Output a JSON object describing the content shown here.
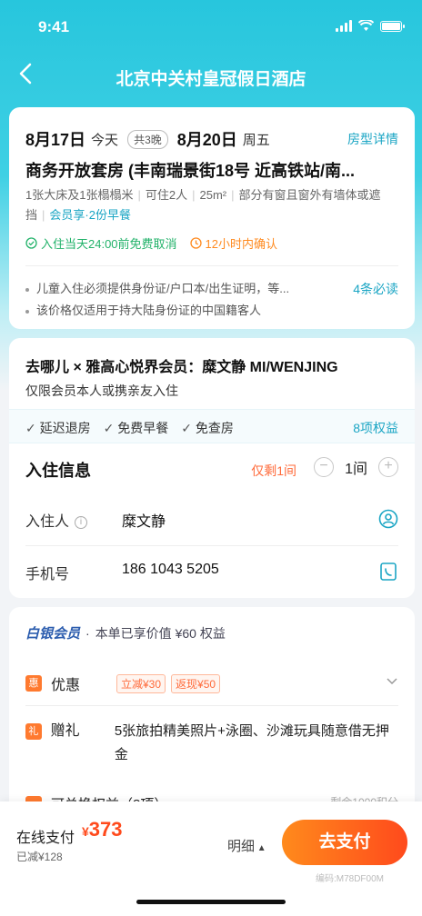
{
  "status_bar": {
    "time": "9:41"
  },
  "nav": {
    "title": "北京中关村皇冠假日酒店",
    "back_icon": "chevron-left-icon"
  },
  "booking": {
    "checkin_date": "8月17日",
    "checkin_day": "今天",
    "nights": "共3晚",
    "checkout_date": "8月20日",
    "checkout_day": "周五",
    "room_detail_link": "房型详情",
    "room_name": "商务开放套房 (丰南瑞景街18号 近高铁站/南...",
    "specs": [
      "1张大床及1张榻榻米",
      "可住2人",
      "25m²",
      "部分有窗且窗外有墙体或遮挡"
    ],
    "member_perk": "会员享·2份早餐",
    "cancel_policy": "入住当天24:00前免费取消",
    "confirm_policy": "12小时内确认",
    "notes": [
      "儿童入住必须提供身份证/户口本/出生证明，等...",
      "该价格仅适用于持大陆身份证的中国籍客人"
    ],
    "notes_link": "4条必读"
  },
  "membership": {
    "title": "去哪儿 × 雅高心悦界会员：糜文静 MI/WENJING",
    "subtitle": "仅限会员本人或携亲友入住",
    "perks": [
      "延迟退房",
      "免费早餐",
      "免查房"
    ],
    "perks_link": "8项权益",
    "checkin_title": "入住信息",
    "rooms_left": "仅剩1间",
    "room_count": "1间",
    "guest_label": "入住人",
    "guest_name": "糜文静",
    "phone_label": "手机号",
    "phone": "186 1043 5205"
  },
  "benefits": {
    "silver_badge": "白银会员",
    "silver_text": "本单已享价值 ¥60 权益",
    "discount_icon": "惠",
    "discount_label": "优惠",
    "discount_tags": [
      "立减¥30",
      "返现¥50"
    ],
    "gift_icon": "礼",
    "gift_label": "赠礼",
    "gift_text": "5张旅拍精美照片+泳圈、沙滩玩具随意借无押金",
    "partial_label": "可兑换权益（8项）",
    "partial_right": "剩余1000积分"
  },
  "footer": {
    "pay_label": "在线支付",
    "currency": "¥",
    "price": "373",
    "saved": "已减¥128",
    "detail": "明细",
    "pay_button": "去支付",
    "order_code": "编码:M78DF00M"
  },
  "colors": {
    "accent": "#1aa5c4",
    "price": "#ff4a1c",
    "green": "#22b26a",
    "orange": "#ff8a1f"
  }
}
